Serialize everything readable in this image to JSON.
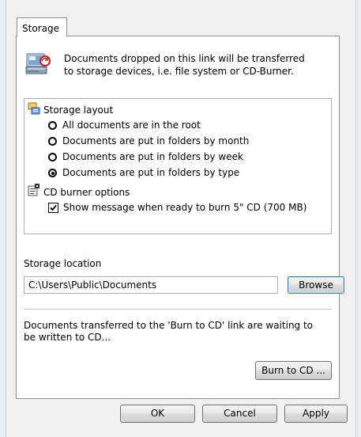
{
  "tab": {
    "label": "Storage"
  },
  "intro": {
    "icon": "storage-transfer-icon",
    "text": "Documents dropped on this link will be transferred to storage devices, i.e. file system or CD-Burner."
  },
  "options": {
    "storage_layout": {
      "icon": "folder-tree-icon",
      "label": "Storage layout",
      "radios": [
        {
          "label": "All documents are in the root",
          "checked": false
        },
        {
          "label": "Documents are put in folders by month",
          "checked": false
        },
        {
          "label": "Documents are put in folders by week",
          "checked": false
        },
        {
          "label": "Documents are put in folders by type",
          "checked": true
        }
      ]
    },
    "cd_burner": {
      "icon": "cd-burner-settings-icon",
      "label": "CD burner options",
      "checkbox": {
        "label": "Show message when ready to burn 5\" CD (700 MB)",
        "checked": true
      }
    }
  },
  "storage_location": {
    "label": "Storage location",
    "value": "C:\\Users\\Public\\Documents",
    "browse_label": "Browse"
  },
  "burn": {
    "description": "Documents transferred to the 'Burn to CD' link are waiting to be written to CD...",
    "button_label": "Burn to CD ..."
  },
  "footer": {
    "ok_label": "OK",
    "cancel_label": "Cancel",
    "apply_label": "Apply"
  }
}
